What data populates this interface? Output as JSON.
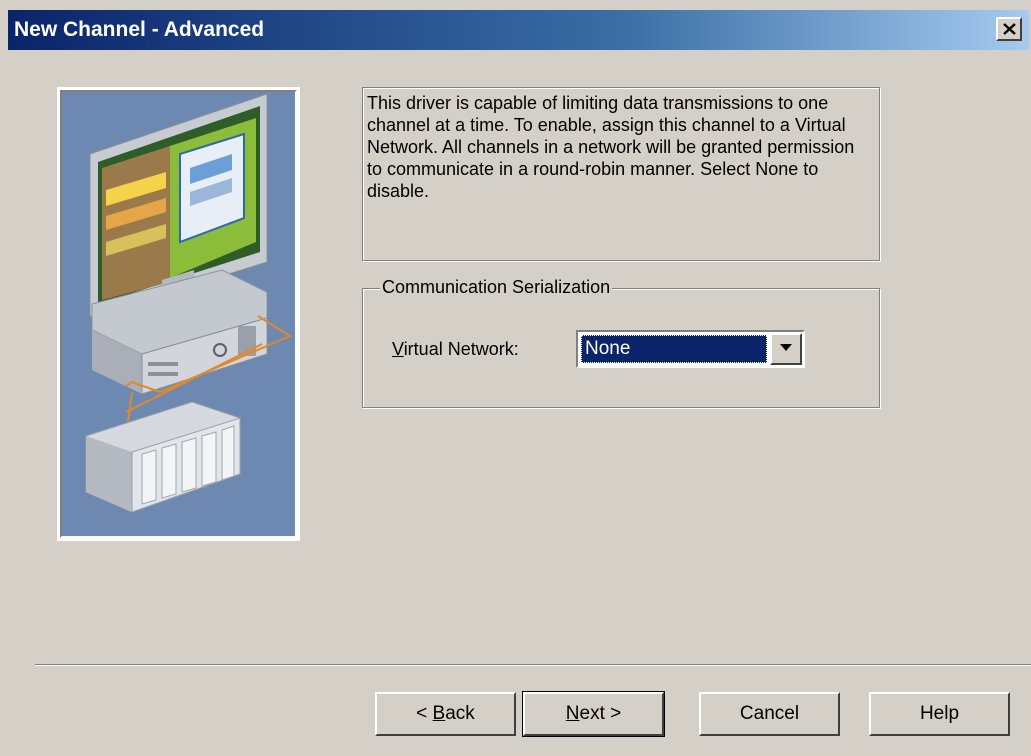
{
  "window": {
    "title": "New Channel - Advanced",
    "close_label": "×"
  },
  "description": "This driver is capable of limiting data transmissions to one channel at a time.  To enable, assign this channel to a Virtual Network.  All channels in a network will be granted permission to communicate in a round-robin manner.  Select None to disable.",
  "serialization": {
    "group_label": "Communication Serialization",
    "field_label_first": "V",
    "field_label_rest": "irtual Network:",
    "selected_value": "None"
  },
  "buttons": {
    "back_prefix": "< ",
    "back_mnemonic": "B",
    "back_rest": "ack",
    "next_mnemonic": "N",
    "next_rest": "ext >",
    "cancel": "Cancel",
    "help": "Help"
  },
  "colors": {
    "title_start": "#0a246a",
    "title_end": "#a6caf0",
    "face": "#d4d0c8",
    "selection": "#0a246a",
    "art_background": "#6d89b2",
    "cable": "#e0882a"
  },
  "icons": {
    "close": "close-icon",
    "dropdown": "chevron-down-icon",
    "art": "computer-plc-illustration"
  }
}
